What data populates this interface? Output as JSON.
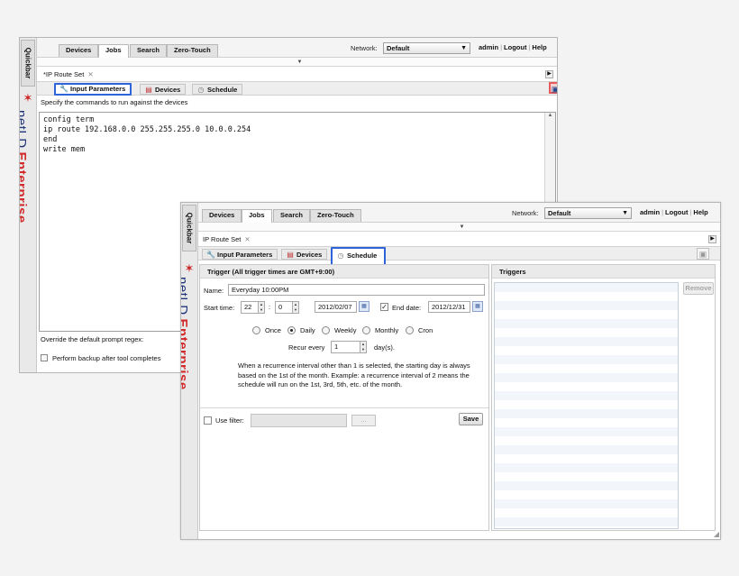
{
  "quickbar_label": "Quickbar",
  "brand": {
    "net": "netLD",
    "enterprise": "Enterprise"
  },
  "nav_tabs": [
    "Devices",
    "Jobs",
    "Search",
    "Zero-Touch"
  ],
  "network": {
    "label": "Network:",
    "value": "Default"
  },
  "links": {
    "admin": "admin",
    "logout": "Logout",
    "help": "Help"
  },
  "window1": {
    "doc_tab": "*IP Route Set",
    "tabs": [
      "Input Parameters",
      "Devices",
      "Schedule"
    ],
    "instructions": "Specify the commands to run against the devices",
    "commands": "config term\nip route 192.168.0.0 255.255.255.0 10.0.0.254\nend\nwrite mem",
    "regex_label": "Override the default prompt regex:",
    "backup_label": "Perform backup after tool completes"
  },
  "window2": {
    "doc_tab": "IP Route Set",
    "tabs": [
      "Input Parameters",
      "Devices",
      "Schedule"
    ],
    "trigger_header": "Trigger (All trigger times are GMT+9:00)",
    "name_label": "Name:",
    "name_value": "Everyday 10:00PM",
    "start_label": "Start time:",
    "start_hour": "22",
    "start_min": "0",
    "time_sep": ":",
    "start_date": "2012/02/07",
    "end_label": "End date:",
    "end_date": "2012/12/31",
    "recurrence": [
      "Once",
      "Daily",
      "Weekly",
      "Monthly",
      "Cron"
    ],
    "selected_recurrence": "Daily",
    "recur_label": "Recur every",
    "recur_value": "1",
    "recur_unit": "day(s).",
    "description": "When a recurrence interval other than 1 is selected, the starting day is always based on the 1st of the month.  Example: a recurrence interval of 2 means the schedule will run on the 1st, 3rd, 5th, etc. of the month.",
    "use_filter_label": "Use filter:",
    "dots_label": "...",
    "save_label": "Save",
    "triggers_header": "Triggers",
    "remove_label": "Remove"
  }
}
